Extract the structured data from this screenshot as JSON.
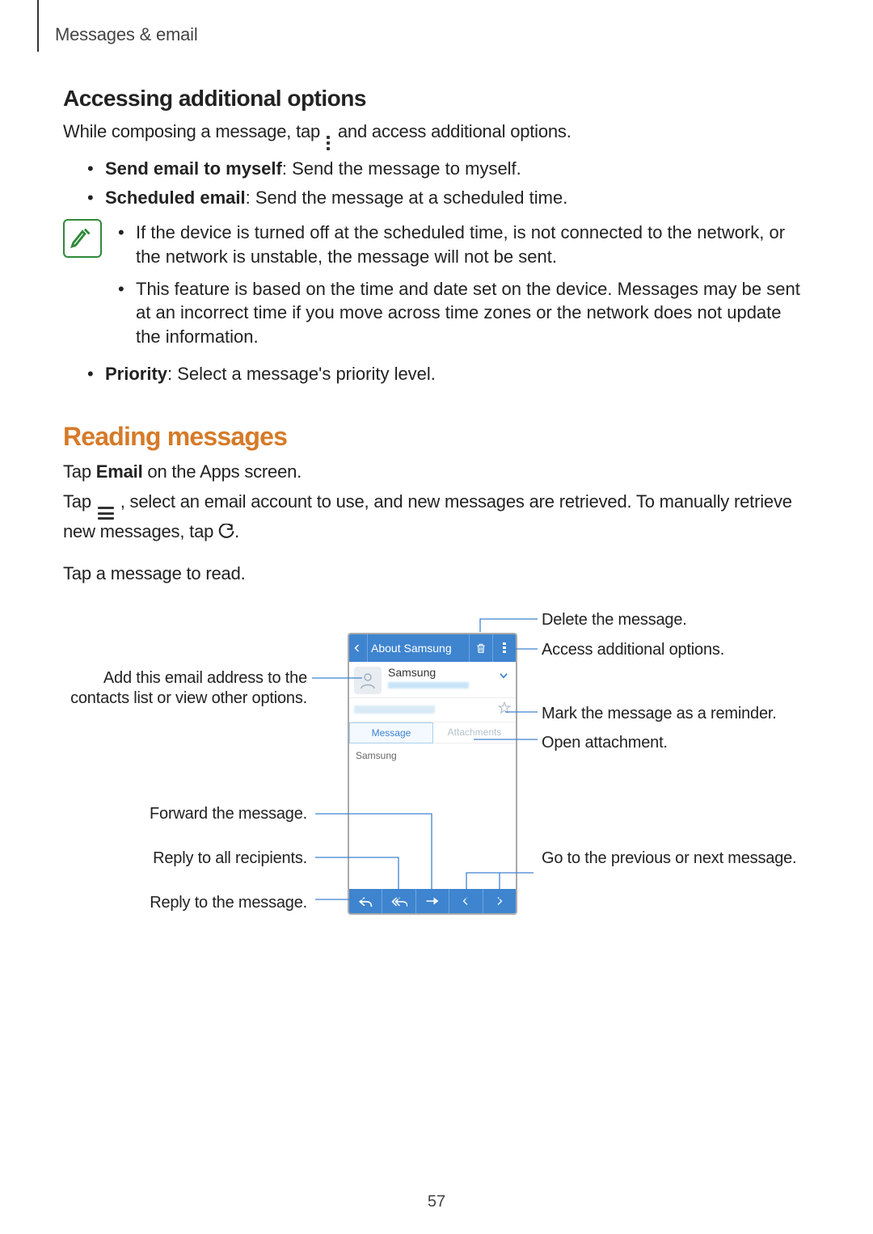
{
  "header": {
    "breadcrumb": "Messages & email"
  },
  "section1": {
    "title": "Accessing additional options",
    "intro_a": "While composing a message, tap ",
    "intro_b": " and access additional options.",
    "bullets": [
      {
        "bold": "Send email to myself",
        "rest": ": Send the message to myself."
      },
      {
        "bold": "Scheduled email",
        "rest": ": Send the message at a scheduled time."
      }
    ],
    "note_bullets": [
      "If the device is turned off at the scheduled time, is not connected to the network, or the network is unstable, the message will not be sent.",
      "This feature is based on the time and date set on the device. Messages may be sent at an incorrect time if you move across time zones or the network does not update the information."
    ],
    "post_bullet": {
      "bold": "Priority",
      "rest": ": Select a message's priority level."
    }
  },
  "section2": {
    "title": "Reading messages",
    "p1_a": "Tap ",
    "p1_b": "Email",
    "p1_c": " on the Apps screen.",
    "p2_a": "Tap ",
    "p2_b": ", select an email account to use, and new messages are retrieved. To manually retrieve new messages, tap ",
    "p2_c": ".",
    "p3": "Tap a message to read."
  },
  "figure": {
    "phone": {
      "back_title": "About Samsung",
      "sender": "Samsung",
      "tab_active": "Message",
      "tab_inactive": "Attachments",
      "body": "Samsung"
    },
    "callouts": {
      "delete": "Delete the message.",
      "more": "Access additional options.",
      "star": "Mark the message as a reminder.",
      "attach": "Open attachment.",
      "prevnext": "Go to the previous or next message.",
      "avatar": "Add this email address to the contacts list or view other options.",
      "forward": "Forward the message.",
      "replyall": "Reply to all recipients.",
      "reply": "Reply to the message."
    }
  },
  "page_number": "57"
}
